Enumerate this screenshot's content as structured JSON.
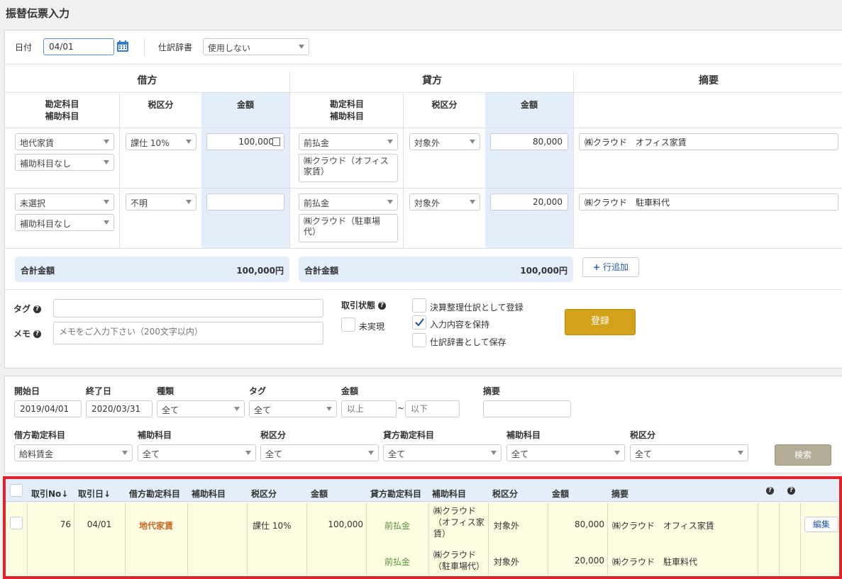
{
  "page": {
    "title": "振替伝票入力"
  },
  "entry": {
    "date_label": "日付",
    "date_value": "04/01",
    "dictionary_label": "仕訳辞書",
    "dictionary_value": "使用しない",
    "debit_header": "借方",
    "credit_header": "貸方",
    "memo_header": "摘要",
    "col_account_line1": "勘定科目",
    "col_account_line2": "補助科目",
    "col_tax": "税区分",
    "col_amount": "金額",
    "rows": [
      {
        "debit_account": "地代家賃",
        "debit_sub": "補助科目なし",
        "debit_tax": "課仕 10%",
        "debit_amount": "100,000",
        "credit_account": "前払金",
        "credit_sub": "㈱クラウド（オフィス家賃）",
        "credit_tax": "対象外",
        "credit_amount": "80,000",
        "memo": "㈱クラウド　オフィス家賃"
      },
      {
        "debit_account": "未選択",
        "debit_sub": "補助科目なし",
        "debit_tax": "不明",
        "debit_amount": "",
        "credit_account": "前払金",
        "credit_sub": "㈱クラウド（駐車場代）",
        "credit_tax": "対象外",
        "credit_amount": "20,000",
        "memo": "㈱クラウド　駐車料代"
      }
    ],
    "debit_total_label": "合計金額",
    "debit_total": "100,000円",
    "credit_total_label": "合計金額",
    "credit_total": "100,000円",
    "add_row_label": "行追加",
    "tag_label": "タグ",
    "memo_label": "メモ",
    "memo_placeholder": "メモをご入力下さい（200文字以内）",
    "status_label": "取引状態",
    "unrealized_label": "未実現",
    "closing_label": "決算整理仕訳として登録",
    "keep_label": "入力内容を保持",
    "keep_checked": true,
    "save_dict_label": "仕訳辞書として保存",
    "register_label": "登録"
  },
  "search": {
    "start_label": "開始日",
    "start_value": "2019/04/01",
    "end_label": "終了日",
    "end_value": "2020/03/31",
    "type_label": "種類",
    "type_value": "全て",
    "tag_label": "タグ",
    "tag_value": "全て",
    "amount_label": "金額",
    "amount_min_placeholder": "以上",
    "amount_max_placeholder": "以下",
    "amount_sep": "~",
    "memo_label": "摘要",
    "debit_account_label": "借方勘定科目",
    "debit_account_value": "給料賃金",
    "debit_sub_label": "補助科目",
    "debit_sub_value": "全て",
    "debit_tax_label": "税区分",
    "debit_tax_value": "全て",
    "credit_account_label": "貸方勘定科目",
    "credit_account_value": "全て",
    "credit_sub_label": "補助科目",
    "credit_sub_value": "全て",
    "credit_tax_label": "税区分",
    "credit_tax_value": "全て",
    "search_button": "検索"
  },
  "results": {
    "headers": {
      "no": "取引No",
      "date": "取引日",
      "debit_account": "借方勘定科目",
      "debit_sub": "補助科目",
      "debit_tax": "税区分",
      "debit_amount": "金額",
      "credit_account": "貸方勘定科目",
      "credit_sub": "補助科目",
      "credit_tax": "税区分",
      "credit_amount": "金額",
      "memo": "摘要"
    },
    "row": {
      "no": "76",
      "date": "04/01",
      "debit_account": "地代家賃",
      "debit_tax": "課仕 10%",
      "debit_amount": "100,000",
      "credit_lines": [
        {
          "account": "前払金",
          "sub": "㈱クラウド（オフィス家賃）",
          "tax": "対象外",
          "amount": "80,000",
          "memo": "㈱クラウド　オフィス家賃"
        },
        {
          "account": "前払金",
          "sub": "㈱クラウド（駐車場代）",
          "tax": "対象外",
          "amount": "20,000",
          "memo": "㈱クラウド　駐車料代"
        }
      ],
      "edit_label": "編集"
    }
  },
  "colors": {
    "accent_gold": "#d4a21a",
    "highlight_red": "#e0222b",
    "header_blue": "#e3eefa",
    "row_yellow": "#fdfde2"
  }
}
